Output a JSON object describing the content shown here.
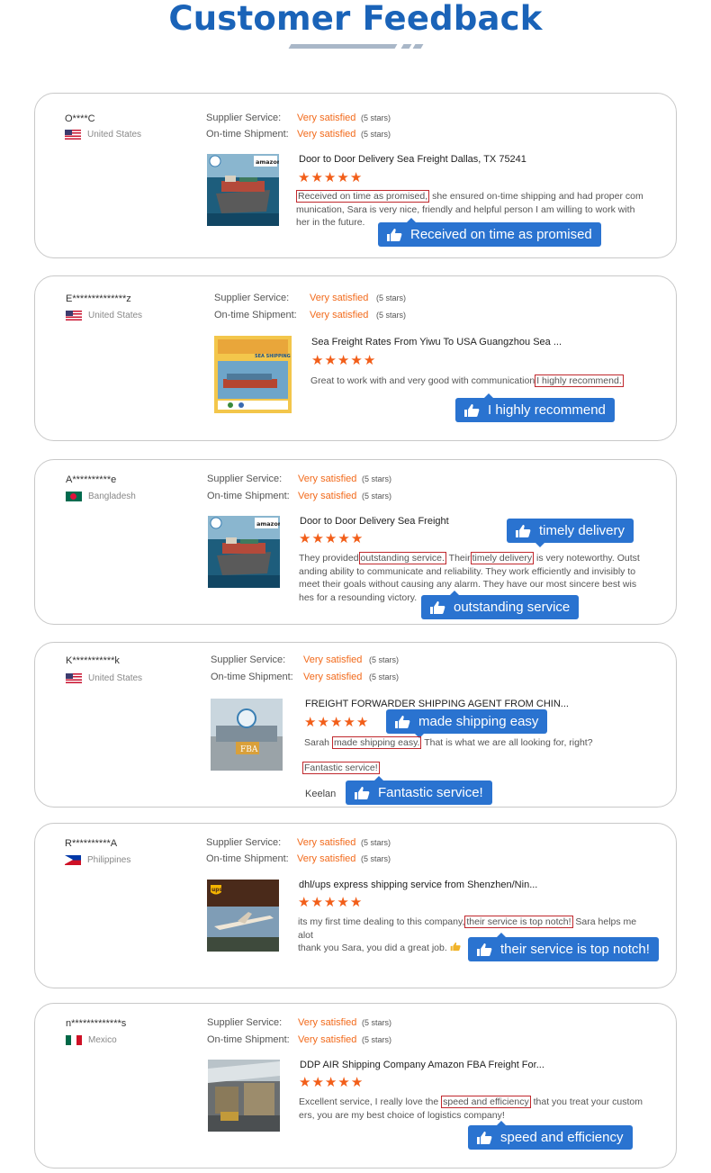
{
  "header": {
    "title": "Customer Feedback"
  },
  "labels": {
    "supplier_service": "Supplier Service:",
    "ontime_shipment": "On-time Shipment:"
  },
  "icons": {
    "thumbs_up": "thumbs-up-icon",
    "star": "star-icon",
    "flag": "flag-icon"
  },
  "colors": {
    "title": "#1a63b8",
    "accent_orange": "#f26a1b",
    "pill_blue": "#2a73d0",
    "highlight_red": "#c0282d"
  },
  "reviews": [
    {
      "user": "O****C",
      "country": "United States",
      "supplier_service": "Very satisfied",
      "supplier_stars": "(5 stars)",
      "ontime_shipment": "Very satisfied",
      "ontime_stars": "(5 stars)",
      "product": "Door to Door Delivery Sea Freight Dallas, TX 75241",
      "rating": 5,
      "review_parts": [
        "Received on time as promised,",
        " she ensured on-time shipping and had proper com munication, Sara is very nice, friendly and helpful person I am willing to work with her in the future."
      ],
      "tag": "Received on time as promised"
    },
    {
      "user": "E**************z",
      "country": "United States",
      "supplier_service": "Very satisfied",
      "supplier_stars": "(5 stars)",
      "ontime_shipment": "Very satisfied",
      "ontime_stars": "(5 stars)",
      "product": "Sea Freight Rates From Yiwu To USA Guangzhou Sea ...",
      "rating": 5,
      "review_parts": [
        "Great to work with and very good with communication",
        "I highly recommend."
      ],
      "tag": "I highly recommend"
    },
    {
      "user": "A**********e",
      "country": "Bangladesh",
      "supplier_service": "Very satisfied",
      "supplier_stars": "(5 stars)",
      "ontime_shipment": "Very satisfied",
      "ontime_stars": "(5 stars)",
      "product": "Door to Door Delivery Sea Freight",
      "rating": 5,
      "review_parts": [
        "They provided",
        "outstanding service.",
        " Their",
        "timely delivery",
        " is very noteworthy. Outst anding ability to communicate and reliability. They work efficiently and invisibly to meet their goals without causing any alarm. They have our most sincere best wis hes for a resounding victory."
      ],
      "tags": [
        "timely delivery",
        "outstanding service"
      ]
    },
    {
      "user": "K***********k",
      "country": "United States",
      "supplier_service": "Very satisfied",
      "supplier_stars": "(5 stars)",
      "ontime_shipment": "Very satisfied",
      "ontime_stars": "(5 stars)",
      "product": "FREIGHT FORWARDER SHIPPING AGENT FROM CHIN...",
      "rating": 5,
      "review_parts": [
        "Sarah ",
        "made shipping easy.",
        " That is what we are all looking for, right?",
        "Fantastic service!"
      ],
      "signature": "Keelan",
      "tags": [
        "made shipping easy",
        "Fantastic service!"
      ],
      "thumb_text": "FBA"
    },
    {
      "user": "R**********A",
      "country": "Philippines",
      "supplier_service": "Very satisfied",
      "supplier_stars": "(5 stars)",
      "ontime_shipment": "Very satisfied",
      "ontime_stars": "(5 stars)",
      "product": "dhl/ups express shipping service from Shenzhen/Nin...",
      "rating": 5,
      "review_parts": [
        "its my first time dealing to this company,",
        "their service is top notch!",
        " Sara helps me alot",
        "thank you Sara, you did a great job."
      ],
      "tag": "their service is top notch!",
      "thumb_text": "ups"
    },
    {
      "user": "n*************s",
      "country": "Mexico",
      "supplier_service": "Very satisfied",
      "supplier_stars": "(5 stars)",
      "ontime_shipment": "Very satisfied",
      "ontime_stars": "(5 stars)",
      "product": "DDP AIR Shipping Company Amazon FBA Freight For...",
      "rating": 5,
      "review_parts": [
        "Excellent service, I really love the ",
        "speed and efficiency",
        " that you treat your custom ers, you are my best choice of logistics company!"
      ],
      "tag": "speed and efficiency"
    }
  ],
  "thumb_labels": {
    "amazon": "amazon",
    "sea_shipping": "SEA SHIPPING"
  }
}
